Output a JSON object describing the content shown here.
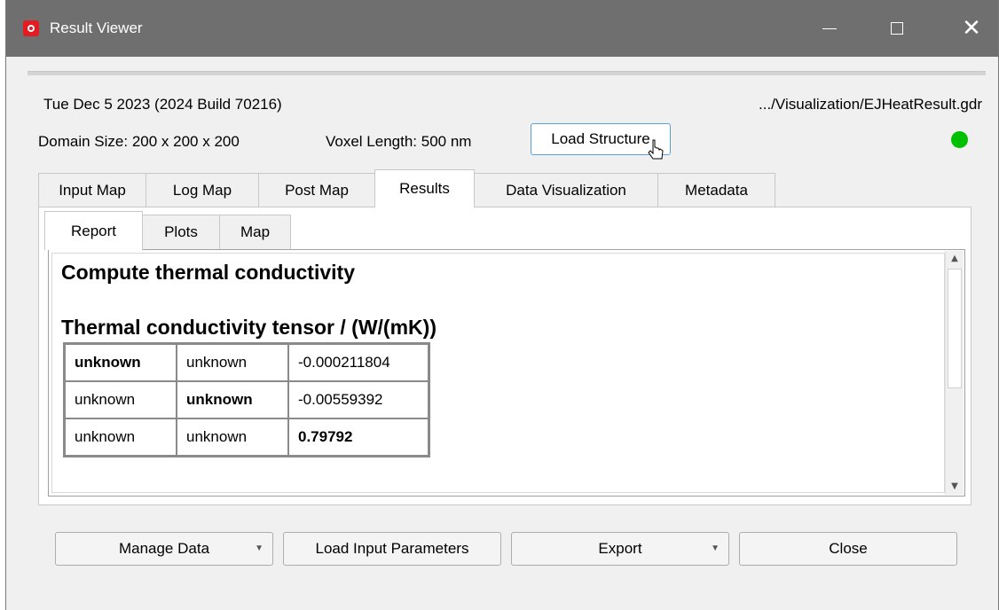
{
  "window": {
    "title": "Result Viewer"
  },
  "header": {
    "date_build": "Tue Dec 5 2023 (2024 Build 70216)",
    "file_path": ".../Visualization/EJHeatResult.gdr",
    "domain_size": "Domain Size: 200 x 200 x 200",
    "voxel_length": "Voxel Length: 500 nm",
    "load_structure_label": "Load Structure",
    "status_color": "#00c000",
    "splitter_dots": "........"
  },
  "tabs": [
    {
      "label": "Input Map"
    },
    {
      "label": "Log Map"
    },
    {
      "label": "Post Map"
    },
    {
      "label": "Results",
      "active": true
    },
    {
      "label": "Data Visualization"
    },
    {
      "label": "Metadata"
    }
  ],
  "subtabs": [
    {
      "label": "Report",
      "active": true
    },
    {
      "label": "Plots"
    },
    {
      "label": "Map"
    }
  ],
  "report": {
    "heading": "Compute thermal conductivity",
    "tensor_title": "Thermal conductivity tensor / (W/(mK))",
    "tensor": [
      [
        "unknown",
        "unknown",
        "-0.000211804"
      ],
      [
        "unknown",
        "unknown",
        "-0.00559392"
      ],
      [
        "unknown",
        "unknown",
        "0.79792"
      ]
    ]
  },
  "buttons": {
    "manage_data": "Manage Data",
    "load_input_parameters": "Load Input Parameters",
    "export": "Export",
    "close": "Close"
  },
  "icons": {
    "app": "app-logo-icon",
    "minimize": "minimize-icon",
    "maximize": "maximize-icon",
    "close": "close-icon",
    "dropdown": "chevron-down-icon"
  }
}
